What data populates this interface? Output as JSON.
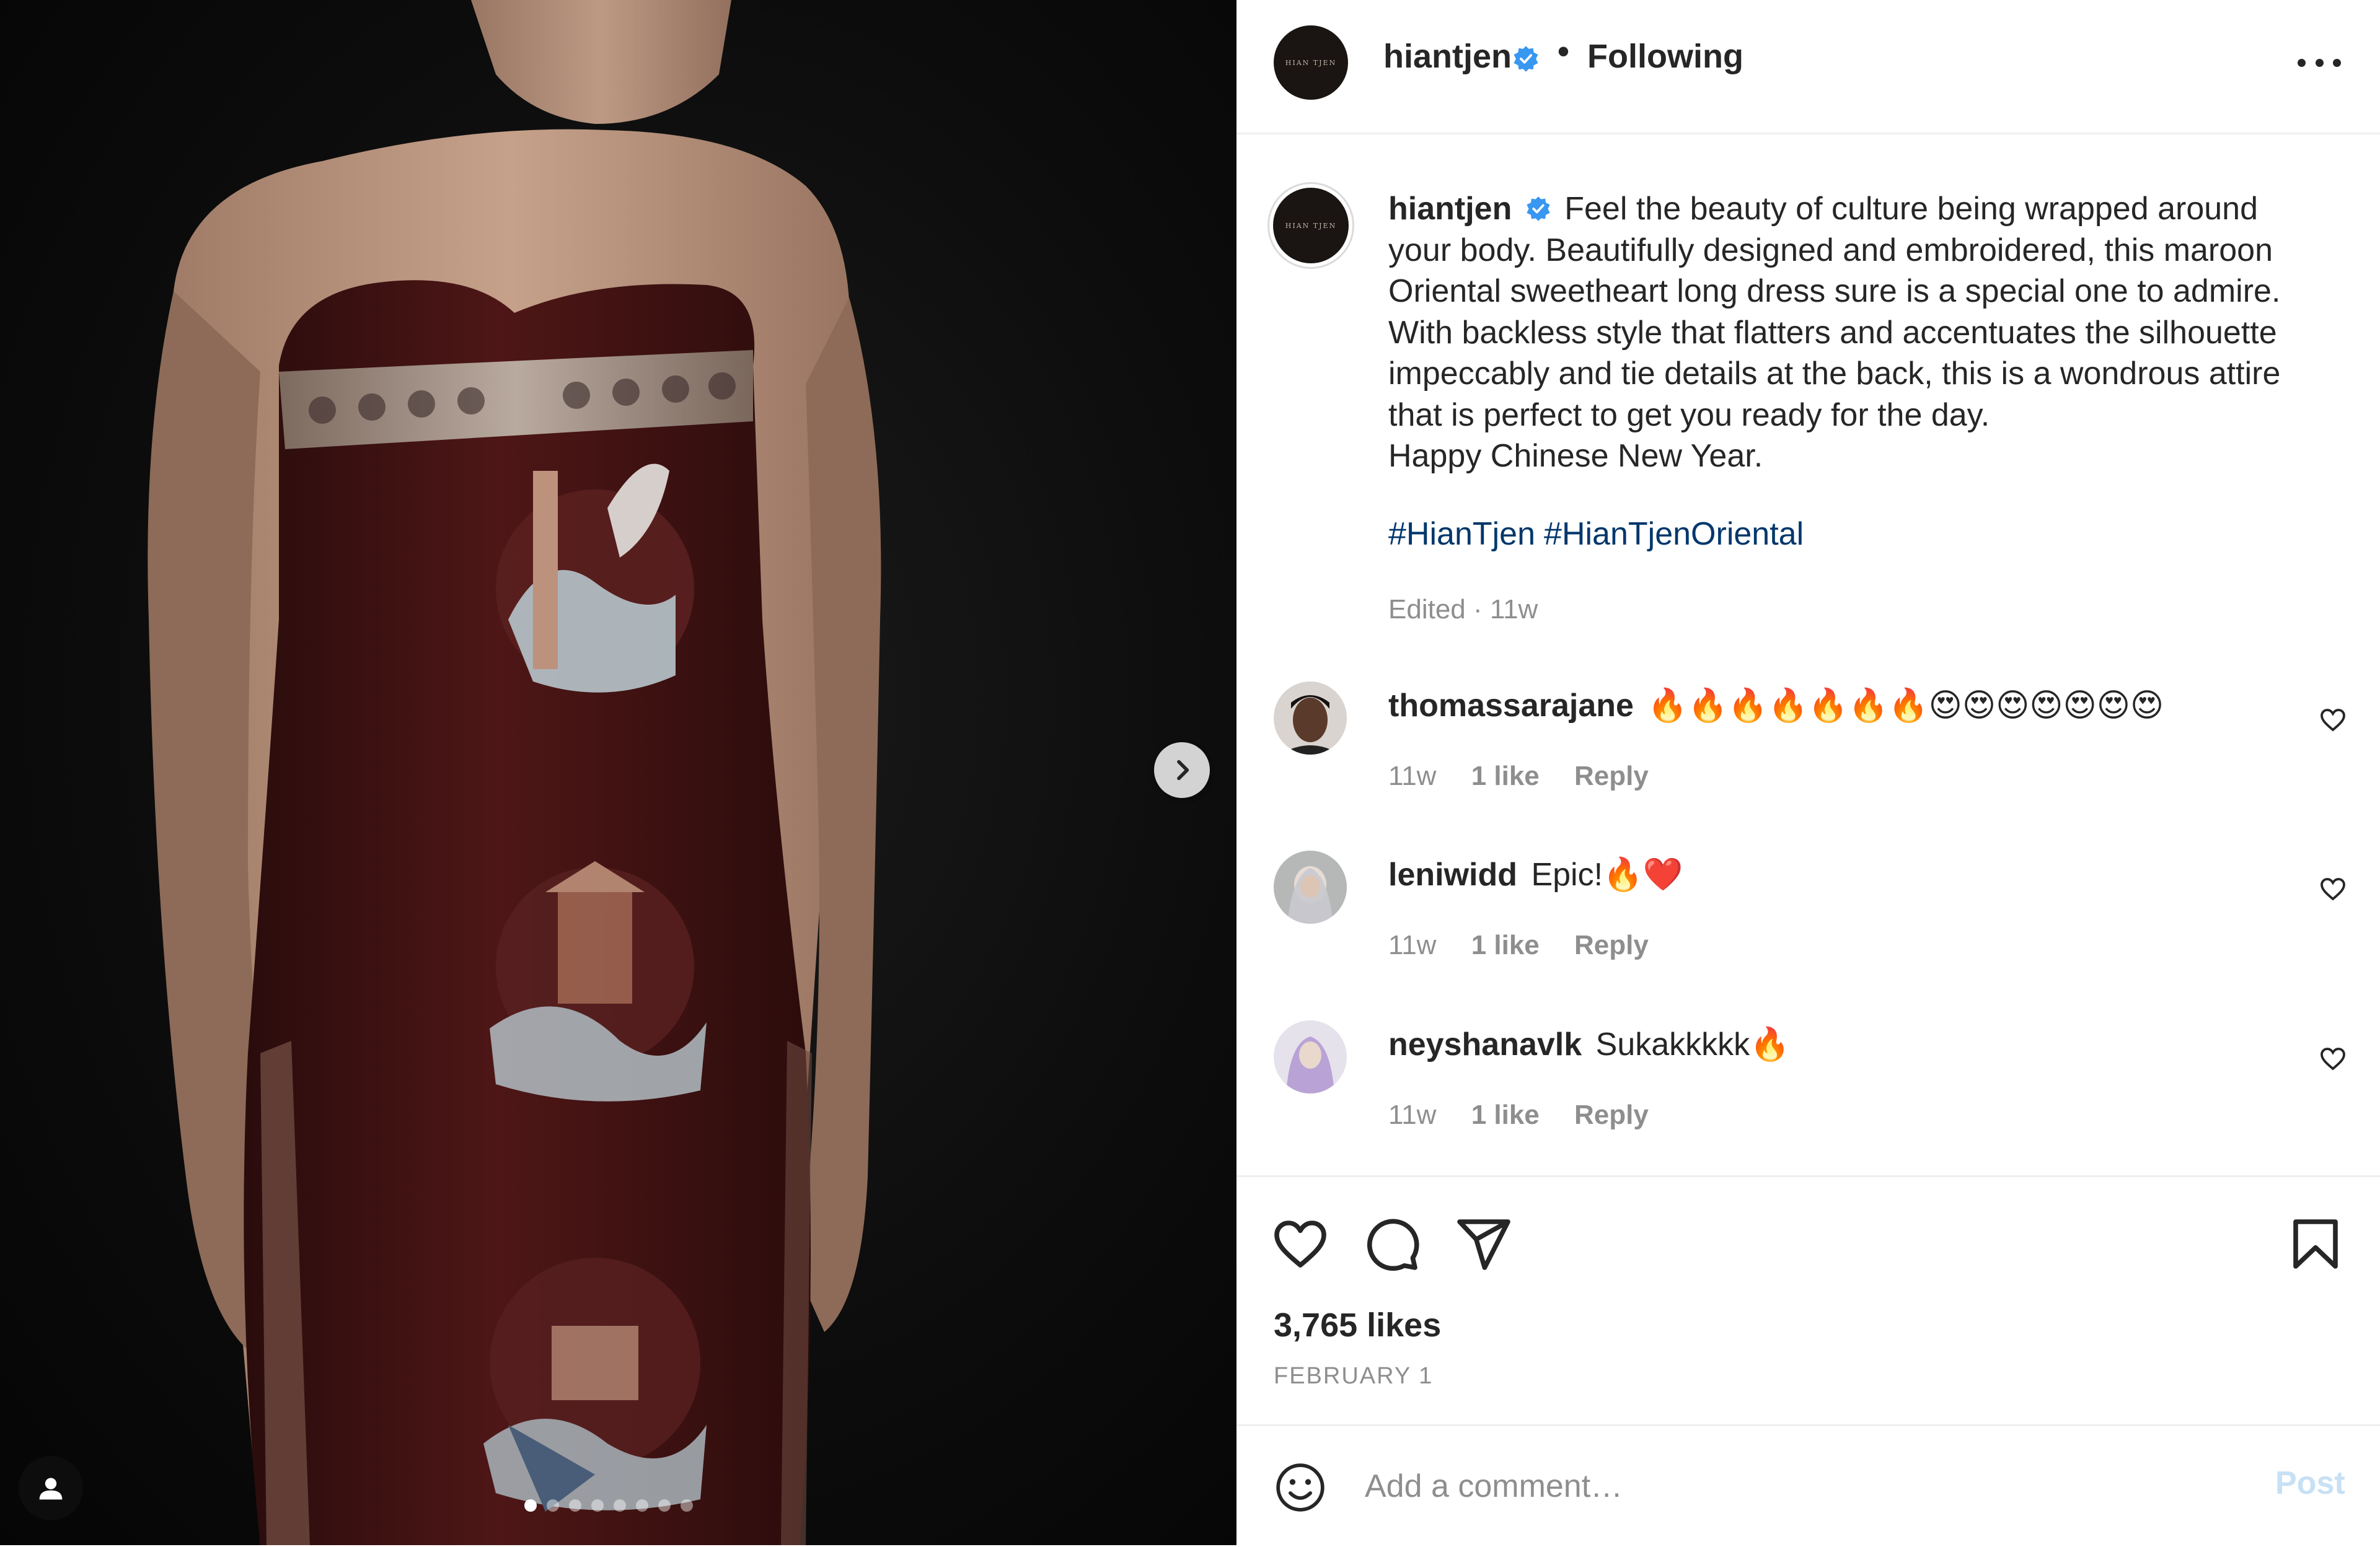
{
  "colors": {
    "accent_blue": "#0095f6",
    "verified_blue": "#3897f0",
    "hashtag": "#00376b",
    "muted_text": "#8e8e8e",
    "dress_maroon": "#4a1414",
    "post_disabled": "#c7e0f4"
  },
  "media": {
    "carousel_count": 8,
    "carousel_active_index": 0,
    "next_icon": "chevron-right-icon",
    "tag_icon": "user-tag-icon"
  },
  "header": {
    "username": "hiantjen",
    "separator": "•",
    "follow_label": "Following",
    "more_icon": "more-horizontal-icon"
  },
  "caption": {
    "username": "hiantjen",
    "lines": [
      "Feel the beauty of culture being wrapped around",
      "your body. Beautifully designed and embroidered, this maroon",
      "Oriental sweetheart long dress sure is a special one to admire.",
      "With backless style that flatters and accentuates the silhouette",
      "impeccably and tie details at the back, this is a wondrous attire",
      "that is perfect to get you ready for the day.",
      "Happy Chinese New Year."
    ],
    "hashtags": [
      "#HianTjen",
      "#HianTjenOriental"
    ],
    "meta": "Edited · 11w"
  },
  "comments": [
    {
      "username": "thomassarajane",
      "text": "🔥🔥🔥🔥🔥🔥🔥😍😍😍😍😍😍😍",
      "time": "11w",
      "likes": "1 like",
      "reply": "Reply"
    },
    {
      "username": "leniwidd",
      "text": "Epic!🔥❤️",
      "time": "11w",
      "likes": "1 like",
      "reply": "Reply"
    },
    {
      "username": "neyshanavlk",
      "text": "Sukakkkkk🔥",
      "time": "11w",
      "likes": "1 like",
      "reply": "Reply"
    }
  ],
  "actions": {
    "like_icon": "heart-icon",
    "comment_icon": "comment-icon",
    "share_icon": "send-icon",
    "save_icon": "bookmark-icon",
    "likes_count": "3,765 likes",
    "date": "FEBRUARY 1"
  },
  "add_comment": {
    "placeholder": "Add a comment…",
    "post_label": "Post",
    "emoji_icon": "emoji-icon"
  }
}
